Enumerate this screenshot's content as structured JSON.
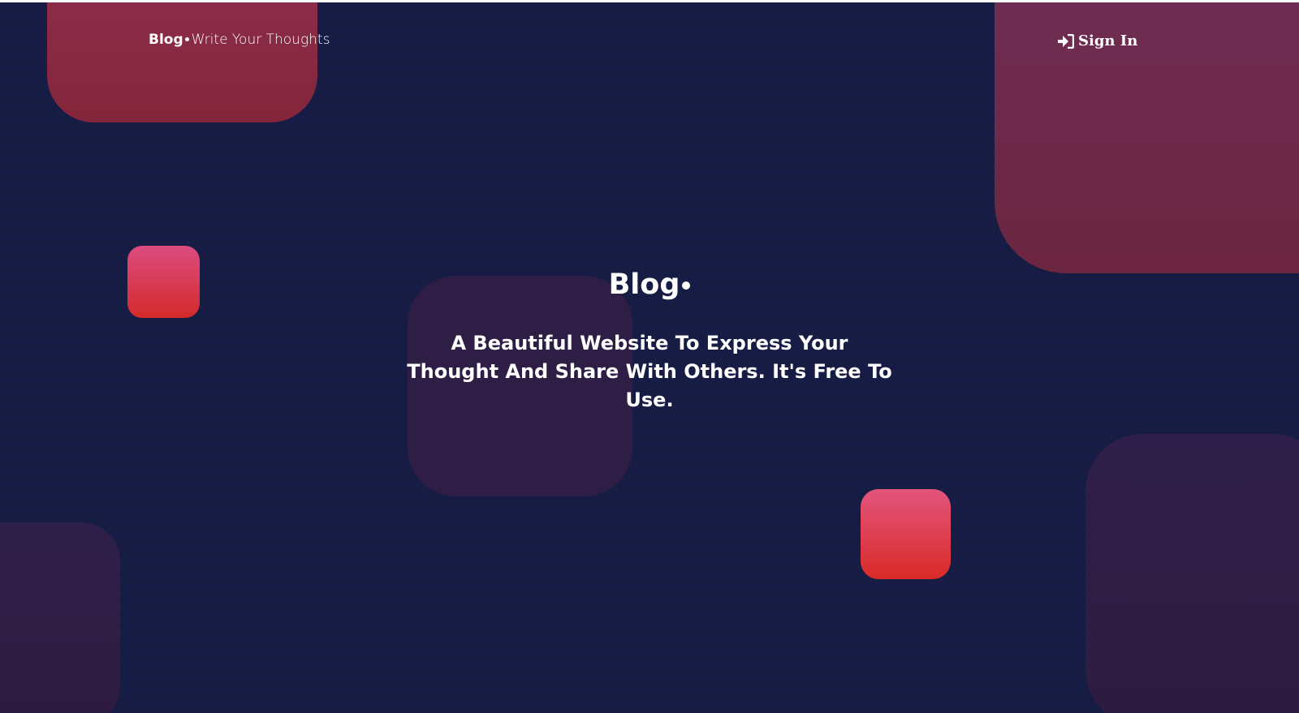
{
  "header": {
    "brand": "Blog",
    "tagline": "Write Your Thoughts",
    "signin_label": "Sign In"
  },
  "hero": {
    "title": "Blog",
    "subtitle": "A Beautiful Website To Express Your Thought And Share With Others. It's Free To Use."
  },
  "colors": {
    "background": "#171c44",
    "accent_pink": "#dc4c80",
    "accent_red": "#d42a2a",
    "shape_maroon": "#83253a",
    "shape_purple": "#2e1e45"
  },
  "icons": {
    "signin": "sign-in-icon"
  }
}
